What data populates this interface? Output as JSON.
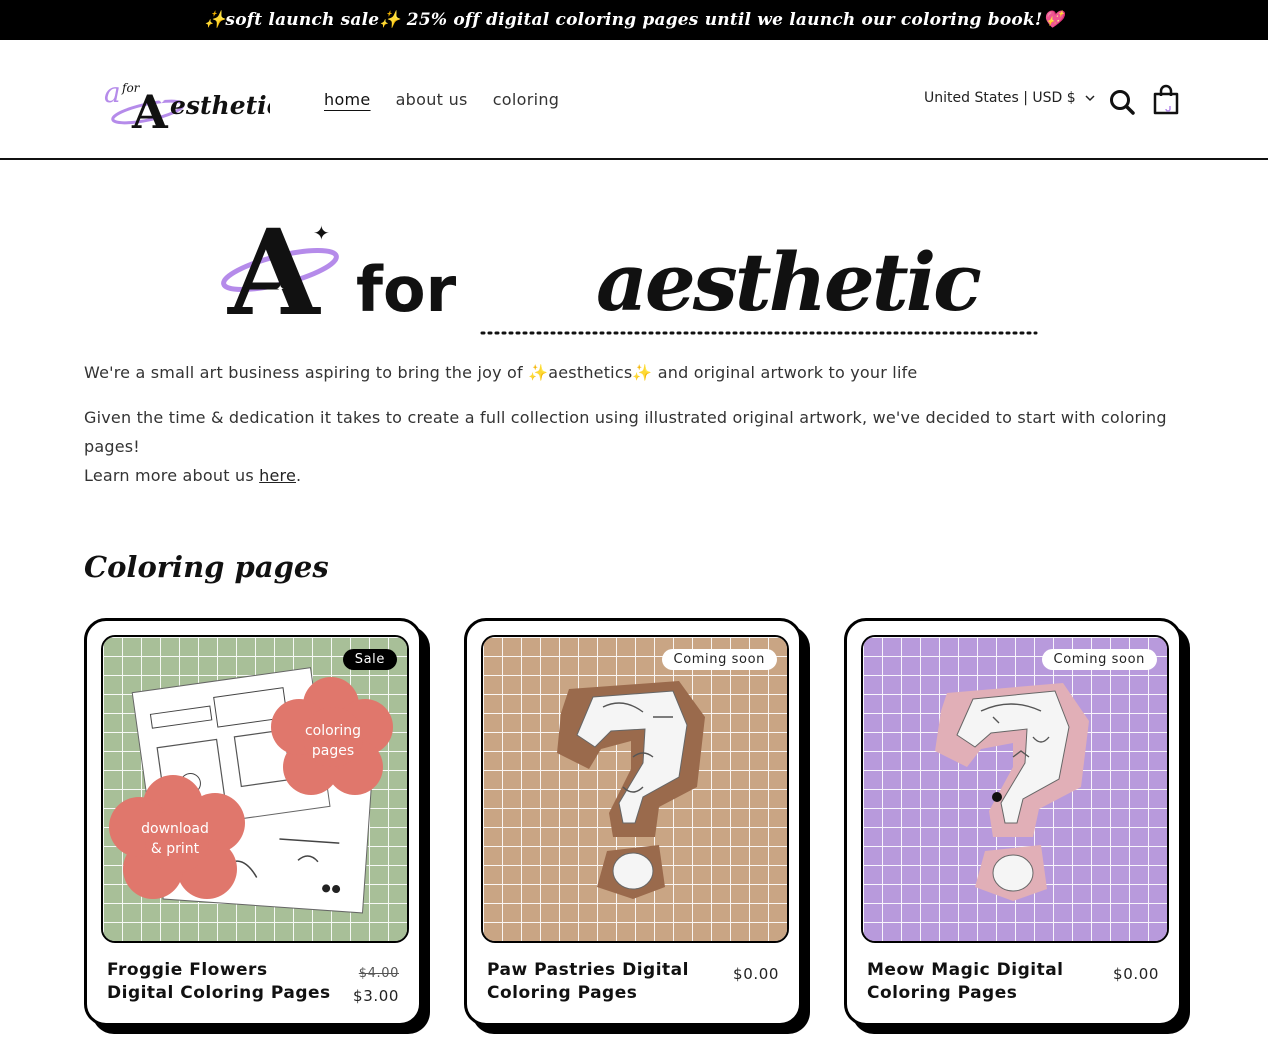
{
  "announcement": "✨soft launch sale✨ 25% off digital coloring pages until we launch our coloring book!💖",
  "header": {
    "logo_text": "A for Aesthetic",
    "nav": [
      {
        "label": "home",
        "active": true
      },
      {
        "label": "about us",
        "active": false
      },
      {
        "label": "coloring",
        "active": false
      }
    ],
    "country_selector": "United States | USD $"
  },
  "hero": {
    "word_for": "for",
    "word_aesthetic": "aesthetic",
    "paragraph1": "We're a small art business aspiring to bring the joy of ✨aesthetics✨ and original artwork to your life",
    "paragraph2": "Given the time & dedication it takes to create a full collection using illustrated original artwork, we've decided to start with coloring pages!",
    "paragraph3_prefix": "Learn more about us ",
    "paragraph3_link": "here",
    "paragraph3_suffix": "."
  },
  "section_title": "Coloring pages",
  "products": [
    {
      "title": "Froggie Flowers Digital Coloring Pages",
      "badge": "Sale",
      "price_old": "$4.00",
      "price": "$3.00",
      "bg_color": "#a8bf98",
      "flower1_text": "coloring pages",
      "flower2_text": "download & print"
    },
    {
      "title": "Paw Pastries Digital Coloring Pages",
      "badge": "Coming soon",
      "price": "$0.00",
      "bg_color": "#c9a584",
      "mark_color": "#9a6a4c"
    },
    {
      "title": "Meow Magic Digital Coloring Pages",
      "badge": "Coming soon",
      "price": "$0.00",
      "bg_color": "#b89adc",
      "mark_color": "#e1afb7"
    }
  ]
}
